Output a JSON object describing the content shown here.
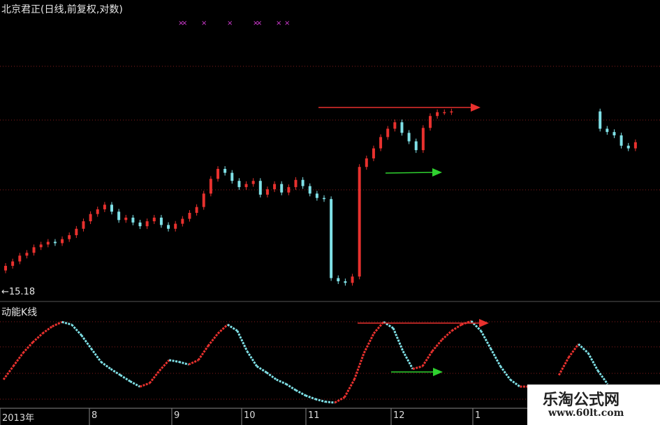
{
  "header": {
    "title": "北京君正(日线,前复权,对数)"
  },
  "indicator": {
    "title": "动能K线"
  },
  "low_marker": {
    "text": "←15.18"
  },
  "watermark": {
    "site_name": "乐淘公式网",
    "url": "www.60lt.com"
  },
  "colors": {
    "up": "#e8312e",
    "down": "#7fe0e6",
    "grid": "#8a1c1c",
    "arrow_red": "#e8312e",
    "arrow_green": "#2fd12f",
    "cross": "#d63bd6"
  },
  "chart_data": [
    {
      "type": "candlestick",
      "title": "北京君正(日线,前复权,对数)",
      "y_scale": "log",
      "annotations": [
        "←15.18"
      ],
      "close_series": [
        15.3,
        15.6,
        16.0,
        16.2,
        16.6,
        16.8,
        17.0,
        16.9,
        17.2,
        17.5,
        18.0,
        18.6,
        19.2,
        19.6,
        20.0,
        19.4,
        18.7,
        18.9,
        18.5,
        18.2,
        18.6,
        18.9,
        18.3,
        18.0,
        18.4,
        18.8,
        19.3,
        19.8,
        21.0,
        22.4,
        23.4,
        23.0,
        22.2,
        21.6,
        21.9,
        22.2,
        20.9,
        21.4,
        21.9,
        21.1,
        21.6,
        22.3,
        21.7,
        21.0,
        20.6,
        20.5,
        14.5,
        14.3,
        14.2,
        14.6,
        23.6,
        24.5,
        25.6,
        26.9,
        27.9,
        28.7,
        27.4,
        26.4,
        25.4,
        28.0,
        29.5,
        30.0,
        30.0,
        30.1,
        27.9,
        27.5,
        27.1,
        25.9,
        25.6,
        26.3
      ],
      "gap_after_index": 63
    },
    {
      "type": "line",
      "title": "动能K线",
      "values": [
        0.3,
        0.45,
        0.6,
        0.72,
        0.82,
        0.9,
        0.95,
        0.92,
        0.8,
        0.65,
        0.5,
        0.42,
        0.35,
        0.28,
        0.22,
        0.26,
        0.4,
        0.52,
        0.5,
        0.47,
        0.52,
        0.68,
        0.82,
        0.92,
        0.85,
        0.62,
        0.45,
        0.38,
        0.3,
        0.25,
        0.18,
        0.12,
        0.08,
        0.05,
        0.04,
        0.1,
        0.3,
        0.6,
        0.82,
        0.95,
        0.88,
        0.62,
        0.42,
        0.45,
        0.62,
        0.75,
        0.85,
        0.92,
        0.96,
        0.85,
        0.65,
        0.45,
        0.3,
        0.22,
        0.22,
        null,
        null,
        0.35,
        0.55,
        0.7,
        0.6,
        0.4,
        0.25
      ],
      "color_rule": "red when rising, cyan when falling"
    }
  ],
  "x_axis": {
    "tick_labels": [
      "2013年",
      "8",
      "9",
      "10",
      "11",
      "12",
      "1"
    ]
  },
  "signals": {
    "cross_count": 6
  }
}
